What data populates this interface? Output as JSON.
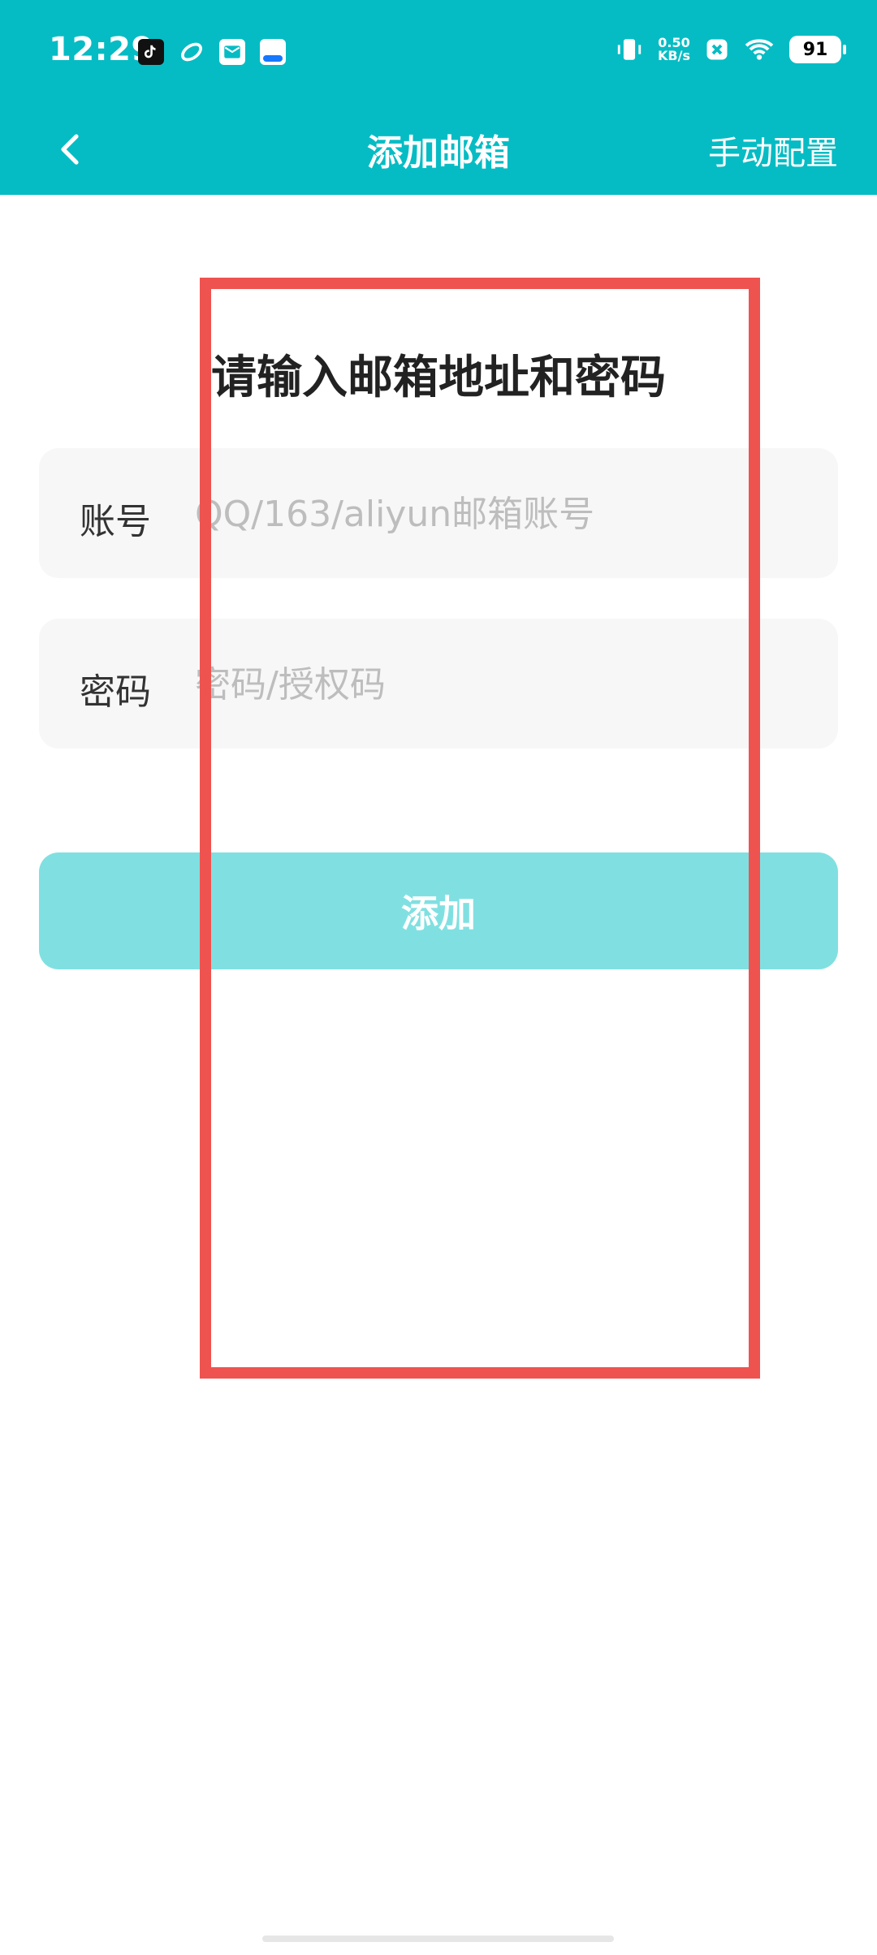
{
  "status_bar": {
    "time": "12:29",
    "net_speed_value": "0.50",
    "net_speed_unit": "KB/s",
    "battery_level": "91",
    "icons_left": [
      "tiktok-icon",
      "moon-icon",
      "mail-icon",
      "tiny-app-icon"
    ],
    "icons_right": [
      "vibrate-icon",
      "network-speed",
      "notification-blocked-icon",
      "wifi-icon",
      "battery-icon"
    ]
  },
  "nav": {
    "title": "添加邮箱",
    "right_action": "手动配置"
  },
  "content": {
    "instruction": "请输入邮箱地址和密码",
    "account": {
      "label": "账号",
      "placeholder": "QQ/163/aliyun邮箱账号",
      "value": ""
    },
    "password": {
      "label": "密码",
      "placeholder": "密码/授权码",
      "value": ""
    },
    "submit_label": "添加"
  },
  "colors": {
    "header_bg": "#06BCC4",
    "button_bg": "#80E0E1",
    "overlay_border": "#EF5350",
    "field_bg": "#F7F7F7",
    "placeholder": "#BDBDBD"
  }
}
